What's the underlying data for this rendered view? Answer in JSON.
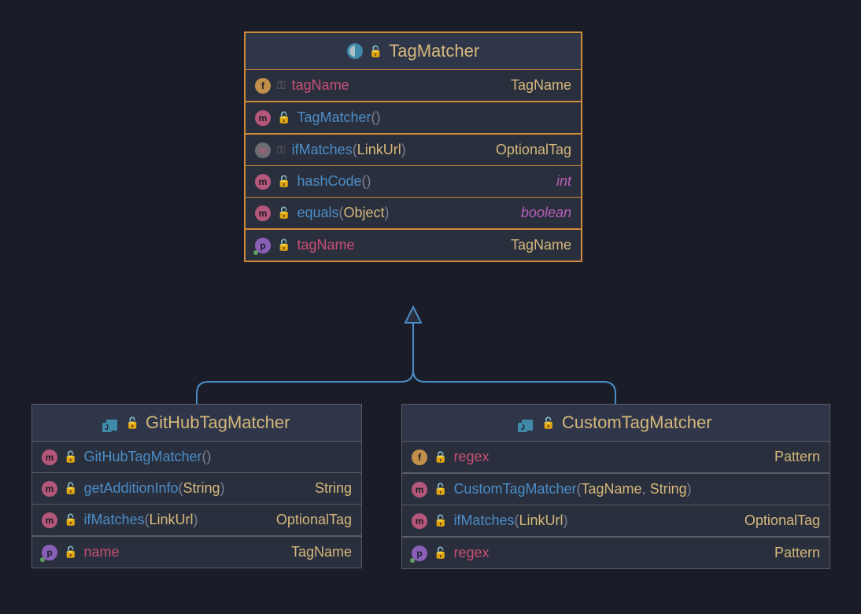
{
  "diagram": {
    "parent_class": {
      "name": "TagMatcher",
      "members": [
        {
          "icon": "field",
          "abstract": false,
          "vis": "key",
          "nameClass": "field",
          "name": "tagName",
          "params": null,
          "ret": "TagName",
          "retClass": ""
        },
        {
          "icon": "method",
          "abstract": false,
          "vis": "open",
          "nameClass": "",
          "name": "TagMatcher",
          "params": "",
          "ret": "",
          "retClass": ""
        },
        {
          "icon": "method",
          "abstract": true,
          "vis": "key",
          "nameClass": "",
          "name": "ifMatches",
          "params": "LinkUrl",
          "ret": "OptionalTag",
          "retClass": ""
        },
        {
          "icon": "method",
          "abstract": false,
          "vis": "open",
          "nameClass": "",
          "name": "hashCode",
          "params": "",
          "ret": "int",
          "retClass": "keyword"
        },
        {
          "icon": "method",
          "abstract": false,
          "vis": "open",
          "nameClass": "",
          "name": "equals",
          "params": "Object",
          "ret": "boolean",
          "retClass": "keyword"
        },
        {
          "icon": "prop",
          "abstract": false,
          "vis": "open",
          "nameClass": "field",
          "name": "tagName",
          "params": null,
          "ret": "TagName",
          "retClass": ""
        }
      ]
    },
    "child_left": {
      "name": "GitHubTagMatcher",
      "members": [
        {
          "icon": "method",
          "abstract": false,
          "vis": "open",
          "nameClass": "",
          "name": "GitHubTagMatcher",
          "params": "",
          "ret": "",
          "retClass": ""
        },
        {
          "icon": "method",
          "abstract": false,
          "vis": "open",
          "nameClass": "",
          "name": "getAdditionInfo",
          "params": "String",
          "ret": "String",
          "retClass": ""
        },
        {
          "icon": "method",
          "abstract": false,
          "vis": "open",
          "nameClass": "",
          "name": "ifMatches",
          "params": "LinkUrl",
          "ret": "OptionalTag",
          "retClass": ""
        },
        {
          "icon": "prop",
          "abstract": false,
          "vis": "open",
          "nameClass": "field",
          "name": "name",
          "params": null,
          "ret": "TagName",
          "retClass": ""
        }
      ]
    },
    "child_right": {
      "name": "CustomTagMatcher",
      "members": [
        {
          "icon": "field",
          "abstract": false,
          "vis": "closed",
          "nameClass": "field",
          "name": "regex",
          "params": null,
          "ret": "Pattern",
          "retClass": ""
        },
        {
          "icon": "method",
          "abstract": false,
          "vis": "open",
          "nameClass": "",
          "name": "CustomTagMatcher",
          "params": "TagName, String",
          "ret": "",
          "retClass": ""
        },
        {
          "icon": "method",
          "abstract": false,
          "vis": "open",
          "nameClass": "",
          "name": "ifMatches",
          "params": "LinkUrl",
          "ret": "OptionalTag",
          "retClass": ""
        },
        {
          "icon": "prop",
          "abstract": false,
          "vis": "open",
          "nameClass": "field",
          "name": "regex",
          "params": null,
          "ret": "Pattern",
          "retClass": ""
        }
      ]
    }
  },
  "colors": {
    "background": "#1a1d28",
    "box_bg": "#2a2f3e",
    "border": "#5a5c64",
    "highlight_border": "#d08a3a",
    "title": "#d4b87a",
    "method": "#4a8dc7",
    "field": "#c94f74",
    "keyword": "#b85fb8",
    "connector": "#4a8dc7"
  }
}
